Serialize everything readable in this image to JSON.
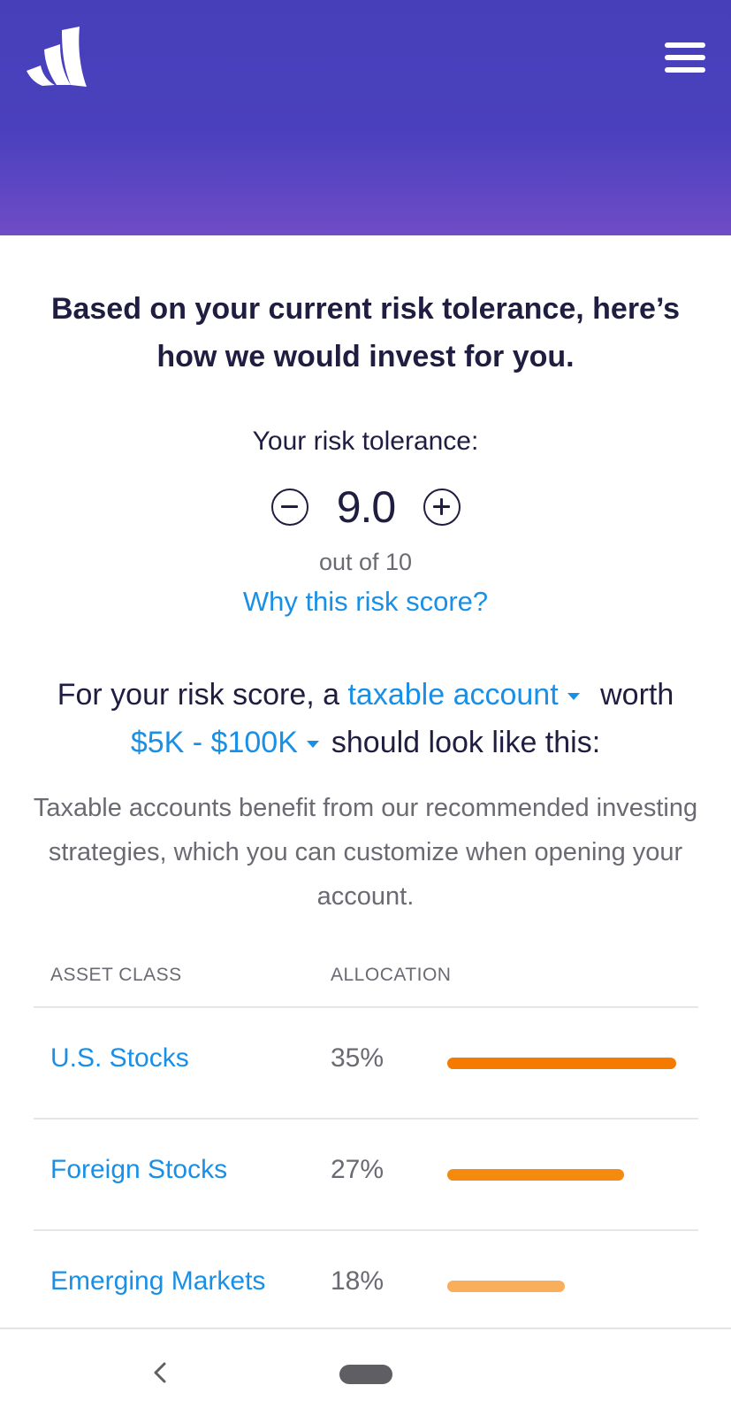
{
  "header": {
    "logo_icon": "wealthfront-logo-icon",
    "menu_icon": "hamburger-menu-icon",
    "gradient_top": "#473fba",
    "gradient_bottom": "#6f4cc6"
  },
  "headline": "Based on your current risk tolerance, here’s how we would invest for you.",
  "risk": {
    "label": "Your risk tolerance:",
    "score": "9.0",
    "out_of": "out of 10",
    "why_link": "Why this risk score?",
    "decrease_icon": "minus-circle-icon",
    "increase_icon": "plus-circle-icon"
  },
  "sentence": {
    "part1": "For your risk score, a ",
    "account_type": "taxable account",
    "part2": " worth",
    "amount_range": "$5K - $100K",
    "part3": "should look like this:"
  },
  "description": "Taxable accounts benefit from our recommended investing strategies, which you can customize when opening your account.",
  "table": {
    "col_asset": "ASSET CLASS",
    "col_allocation": "ALLOCATION",
    "rows": [
      {
        "name": "U.S. Stocks",
        "pct": "35%",
        "allocation": 35,
        "color": "#f47b00"
      },
      {
        "name": "Foreign Stocks",
        "pct": "27%",
        "allocation": 27,
        "color": "#f48a0e"
      },
      {
        "name": "Emerging Markets",
        "pct": "18%",
        "allocation": 18,
        "color": "#f9ae5c"
      }
    ]
  },
  "navbar": {
    "back_icon": "back-chevron-icon",
    "home_icon": "home-pill-icon"
  },
  "colors": {
    "link": "#1a8fe6",
    "text_dark": "#1f1d40",
    "text_muted": "#6a6a72"
  }
}
